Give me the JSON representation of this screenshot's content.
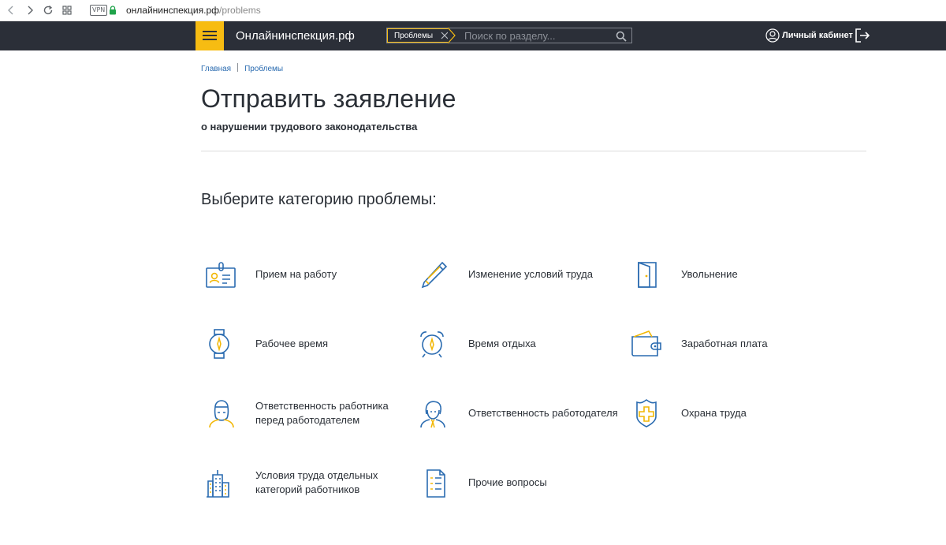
{
  "browser": {
    "vpn_label": "VPN",
    "url_host": "онлайнинспекция.рф",
    "url_path": "/problems"
  },
  "header": {
    "logo_text": "Онлайнинспекция.рф",
    "search_chip": "Проблемы",
    "search_placeholder": "Поиск по разделу...",
    "cabinet_label": "Личный кабинет"
  },
  "breadcrumb": {
    "items": [
      "Главная",
      "Проблемы"
    ]
  },
  "page": {
    "title": "Отправить заявление",
    "subtitle": "о нарушении трудового законодательства",
    "section_title": "Выберите категорию проблемы:"
  },
  "categories": [
    {
      "label": "Прием на работу",
      "icon": "id-badge-icon"
    },
    {
      "label": "Изменение условий труда",
      "icon": "pen-icon"
    },
    {
      "label": "Увольнение",
      "icon": "door-icon"
    },
    {
      "label": "Рабочее время",
      "icon": "wristwatch-icon"
    },
    {
      "label": "Время отдыха",
      "icon": "alarm-clock-icon"
    },
    {
      "label": "Заработная плата",
      "icon": "wallet-icon"
    },
    {
      "label": "Ответственность работника перед работодателем",
      "icon": "worker-icon"
    },
    {
      "label": "Ответственность работодателя",
      "icon": "employer-icon"
    },
    {
      "label": "Охрана труда",
      "icon": "shield-cross-icon"
    },
    {
      "label": "Условия труда отдельных категорий работников",
      "icon": "buildings-icon"
    },
    {
      "label": "Прочие вопросы",
      "icon": "document-list-icon"
    }
  ],
  "colors": {
    "header_bg": "#2b2f38",
    "accent": "#f7bc12",
    "icon_blue": "#2a6bb0",
    "link": "#2a6bb0"
  }
}
